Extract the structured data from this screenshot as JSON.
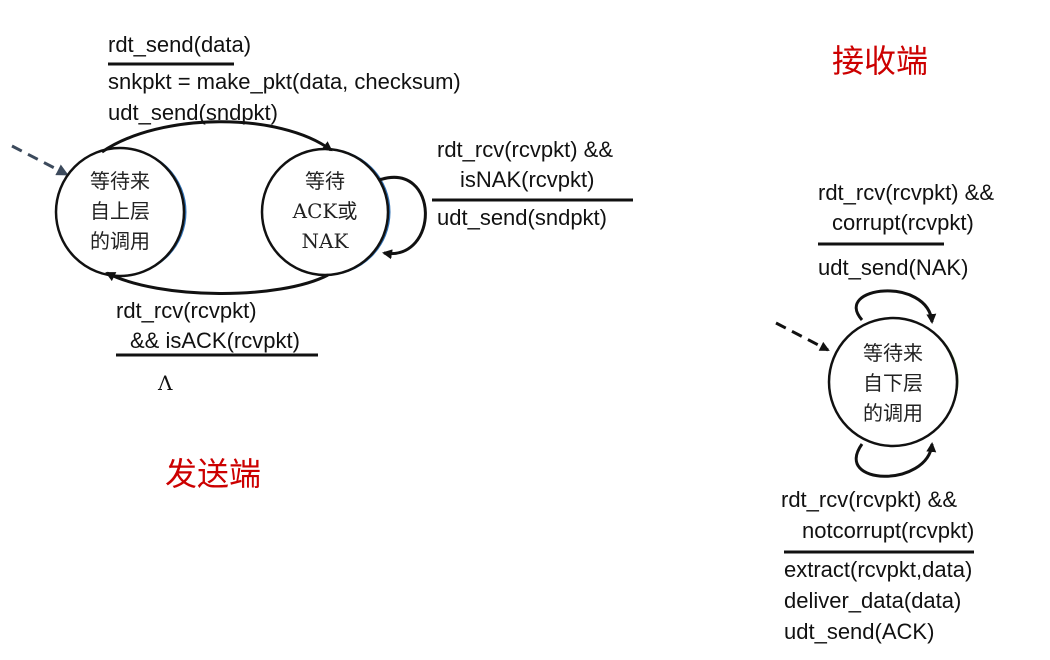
{
  "sender": {
    "role_label": "发送端",
    "states": {
      "wait_call": [
        "等待来",
        "自上层",
        "的调用"
      ],
      "wait_ack": [
        "等待",
        "ACK或",
        "NAK"
      ]
    },
    "transition_send": {
      "event": "rdt_send(data)",
      "actions": [
        "snkpkt = make_pkt(data, checksum)",
        "udt_send(sndpkt)"
      ]
    },
    "transition_nak": {
      "event": [
        "rdt_rcv(rcvpkt) &&",
        "isNAK(rcvpkt)"
      ],
      "action": "udt_send(sndpkt)"
    },
    "transition_ack": {
      "event": [
        "rdt_rcv(rcvpkt)",
        "&& isACK(rcvpkt)"
      ],
      "action": "Λ"
    }
  },
  "receiver": {
    "role_label": "接收端",
    "states": {
      "wait_below": [
        "等待来",
        "自下层",
        "的调用"
      ]
    },
    "transition_corrupt": {
      "event": [
        "rdt_rcv(rcvpkt) &&",
        "corrupt(rcvpkt)"
      ],
      "action": "udt_send(NAK)"
    },
    "transition_notcorrupt": {
      "event": [
        "rdt_rcv(rcvpkt) &&",
        "notcorrupt(rcvpkt)"
      ],
      "actions": [
        "extract(rcvpkt,data)",
        "deliver_data(data)",
        "udt_send(ACK)"
      ]
    }
  },
  "colors": {
    "role_label": "#cc0000",
    "sender_state_accent": "#2e6fb3",
    "receiver_state_accent": "#4a7a2e",
    "line": "#111111",
    "initial_arrow": "#3c4a5c"
  }
}
